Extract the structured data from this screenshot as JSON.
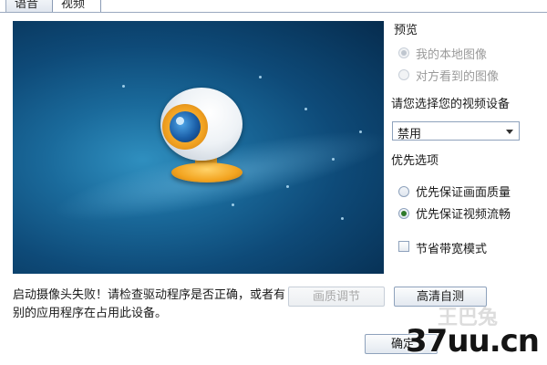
{
  "tabs": [
    {
      "label": "语音"
    },
    {
      "label": "视频"
    }
  ],
  "preview": {
    "title": "预览",
    "options": [
      {
        "label": "我的本地图像",
        "checked": true,
        "disabled": true
      },
      {
        "label": "对方看到的图像",
        "checked": false,
        "disabled": true
      }
    ]
  },
  "device": {
    "prompt": "请您选择您的视频设备",
    "selected": "禁用"
  },
  "priority": {
    "title": "优先选项",
    "options": [
      {
        "label": "优先保证画面质量",
        "checked": false
      },
      {
        "label": "优先保证视频流畅",
        "checked": true
      }
    ]
  },
  "bandwidth": {
    "label": "节省带宽模式",
    "checked": false
  },
  "error_message": "启动摄像头失败！请检查驱动程序是否正确，或者有别的应用程序在占用此设备。",
  "buttons": {
    "quality_adjust": "画质调节",
    "hd_test": "高清自测",
    "confirm": "确定"
  },
  "watermark": {
    "main": "37uu.cn",
    "faint": "王巴兔"
  },
  "icons": {
    "webcam": "webcam-icon"
  }
}
